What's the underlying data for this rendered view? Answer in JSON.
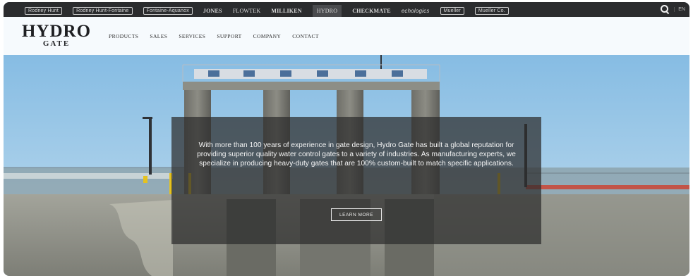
{
  "brand_bar": {
    "brands": [
      {
        "label": "Rodney Hunt",
        "style": "boxed"
      },
      {
        "label": "Rodney Hunt-Fontaine",
        "style": "boxed"
      },
      {
        "label": "Fontaine-Aquanox",
        "style": "boxed"
      },
      {
        "label": "JONES",
        "style": "bold"
      },
      {
        "label": "FLOWTEK",
        "style": "plain"
      },
      {
        "label": "MILLIKEN",
        "style": "bold"
      },
      {
        "label": "HYDRO",
        "style": "active"
      },
      {
        "label": "CHECKMATE",
        "style": "bold"
      },
      {
        "label": "echologics",
        "style": "italic"
      },
      {
        "label": "Mueller",
        "style": "boxed"
      },
      {
        "label": "Mueller Co.",
        "style": "boxed"
      }
    ],
    "language": "EN",
    "search_icon": "search-icon"
  },
  "header": {
    "logo_line1": "HYDRO",
    "logo_line2": "GATE",
    "nav": [
      "PRODUCTS",
      "SALES",
      "SERVICES",
      "SUPPORT",
      "COMPANY",
      "CONTACT"
    ]
  },
  "hero": {
    "text": "With more than 100 years of experience in gate design, Hydro Gate has built a global reputation for providing superior quality water control gates to a variety of industries. As manufacturing experts, we specialize in producing heavy-duty gates that are 100% custom-built to match specific applications.",
    "button_label": "LEARN MORE"
  },
  "colors": {
    "top_bar": "#2b2c2e",
    "header_bg": "#ffffff",
    "overlay": "#2d2d2d",
    "sky": "#9ec9e6"
  }
}
